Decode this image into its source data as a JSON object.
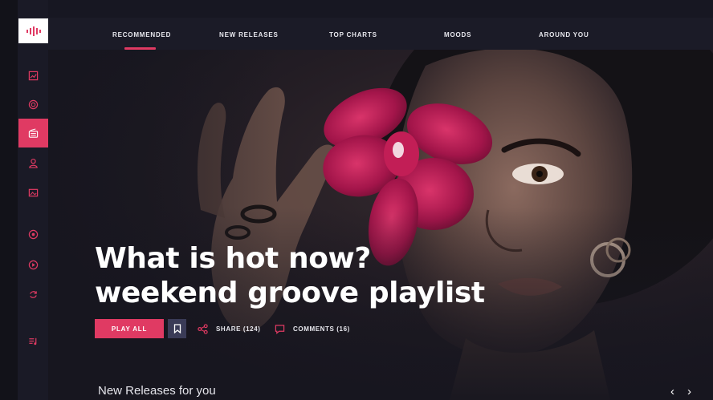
{
  "nav": {
    "items": [
      {
        "label": "RECOMMENDED"
      },
      {
        "label": "NEW RELEASES"
      },
      {
        "label": "TOP CHARTS"
      },
      {
        "label": "MOODS"
      },
      {
        "label": "AROUND YOU"
      }
    ],
    "active": "RECOMMENDED"
  },
  "sidebar": {
    "items": [
      {
        "icon": "image-icon"
      },
      {
        "icon": "podcast-icon"
      },
      {
        "icon": "radio-icon",
        "active": true
      },
      {
        "icon": "user-icon"
      },
      {
        "icon": "gallery-icon"
      },
      {
        "icon": "target-icon"
      },
      {
        "icon": "record-icon"
      },
      {
        "icon": "sync-icon"
      },
      {
        "icon": "playlist-icon"
      }
    ]
  },
  "hero": {
    "title_line1": "What is hot now?",
    "title_line2": "weekend groove playlist",
    "play_label": "PLAY ALL",
    "share_label": "SHARE (124)",
    "comments_label": "COMMENTS (16)"
  },
  "section": {
    "title": "New Releases for you",
    "prev": "‹",
    "next": "›"
  },
  "colors": {
    "accent": "#e03a63",
    "background": "#171722",
    "sidebar": "#1a1a26",
    "bookmark": "#3a3b57"
  }
}
